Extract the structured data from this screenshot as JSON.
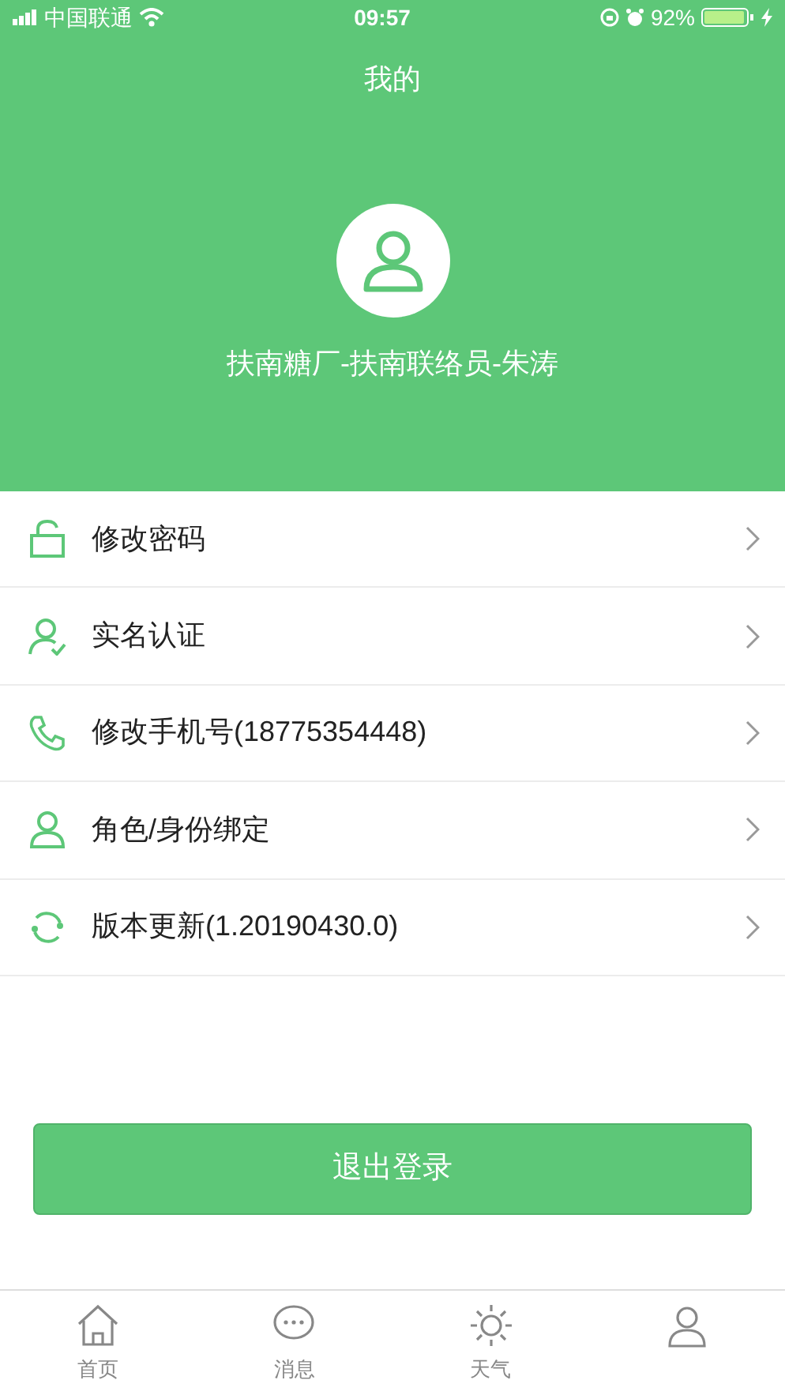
{
  "status_bar": {
    "carrier": "中国联通",
    "time": "09:57",
    "battery": "92%"
  },
  "header": {
    "title": "我的",
    "user_name": "扶南糖厂-扶南联络员-朱涛"
  },
  "menu": [
    {
      "kind": "lock",
      "label": "修改密码"
    },
    {
      "kind": "verify",
      "label": "实名认证"
    },
    {
      "kind": "phone",
      "label": "修改手机号(18775354448)"
    },
    {
      "kind": "person",
      "label": "角色/身份绑定"
    },
    {
      "kind": "refresh",
      "label": "版本更新(1.20190430.0)"
    }
  ],
  "logout_button": "退出登录",
  "tabs": [
    {
      "kind": "home",
      "label": "首页",
      "selected": false
    },
    {
      "kind": "chat",
      "label": "消息",
      "selected": false
    },
    {
      "kind": "sun",
      "label": "天气",
      "selected": false
    }
  ]
}
